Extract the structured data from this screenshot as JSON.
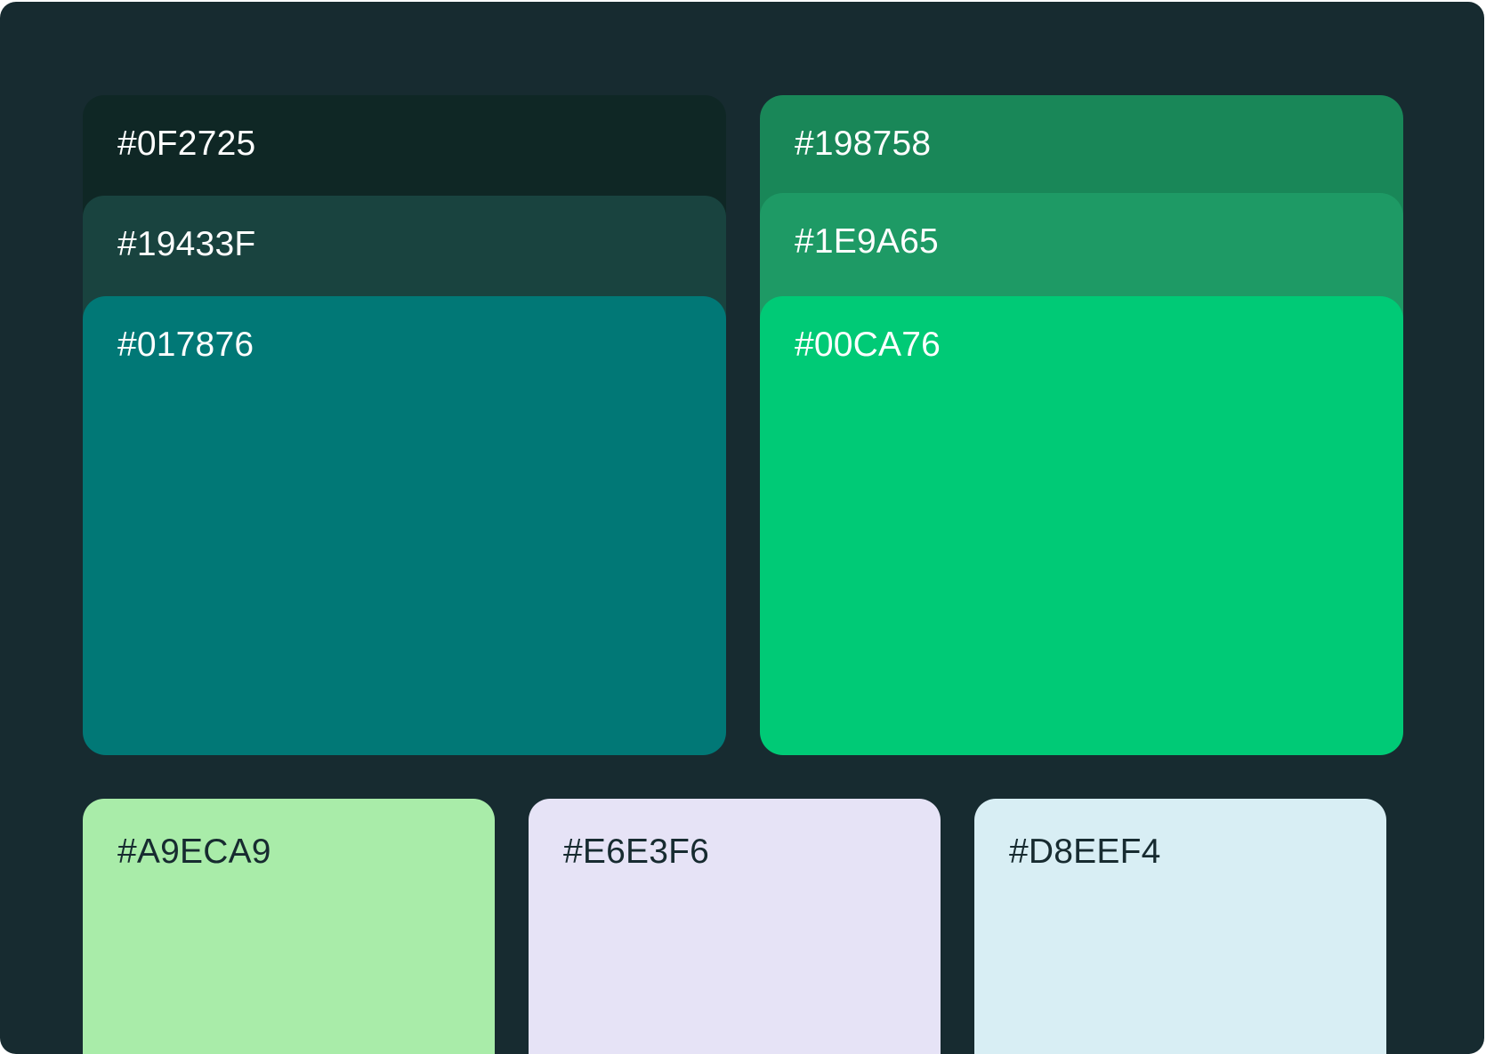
{
  "palette": {
    "frame_color": "#172B30",
    "primary": [
      {
        "label": "#0F2725",
        "color": "#0F2725"
      },
      {
        "label": "#19433F",
        "color": "#19433F"
      },
      {
        "label": "#017876",
        "color": "#017876"
      }
    ],
    "secondary": [
      {
        "label": "#198758",
        "color": "#198758"
      },
      {
        "label": "#1E9A65",
        "color": "#1E9A65"
      },
      {
        "label": "#00CA76",
        "color": "#00CA76"
      }
    ],
    "accents": [
      {
        "label": "#A9ECA9",
        "color": "#A9ECA9"
      },
      {
        "label": "#E6E3F6",
        "color": "#E6E3F6"
      },
      {
        "label": "#D8EEF4",
        "color": "#D8EEF4"
      }
    ]
  }
}
